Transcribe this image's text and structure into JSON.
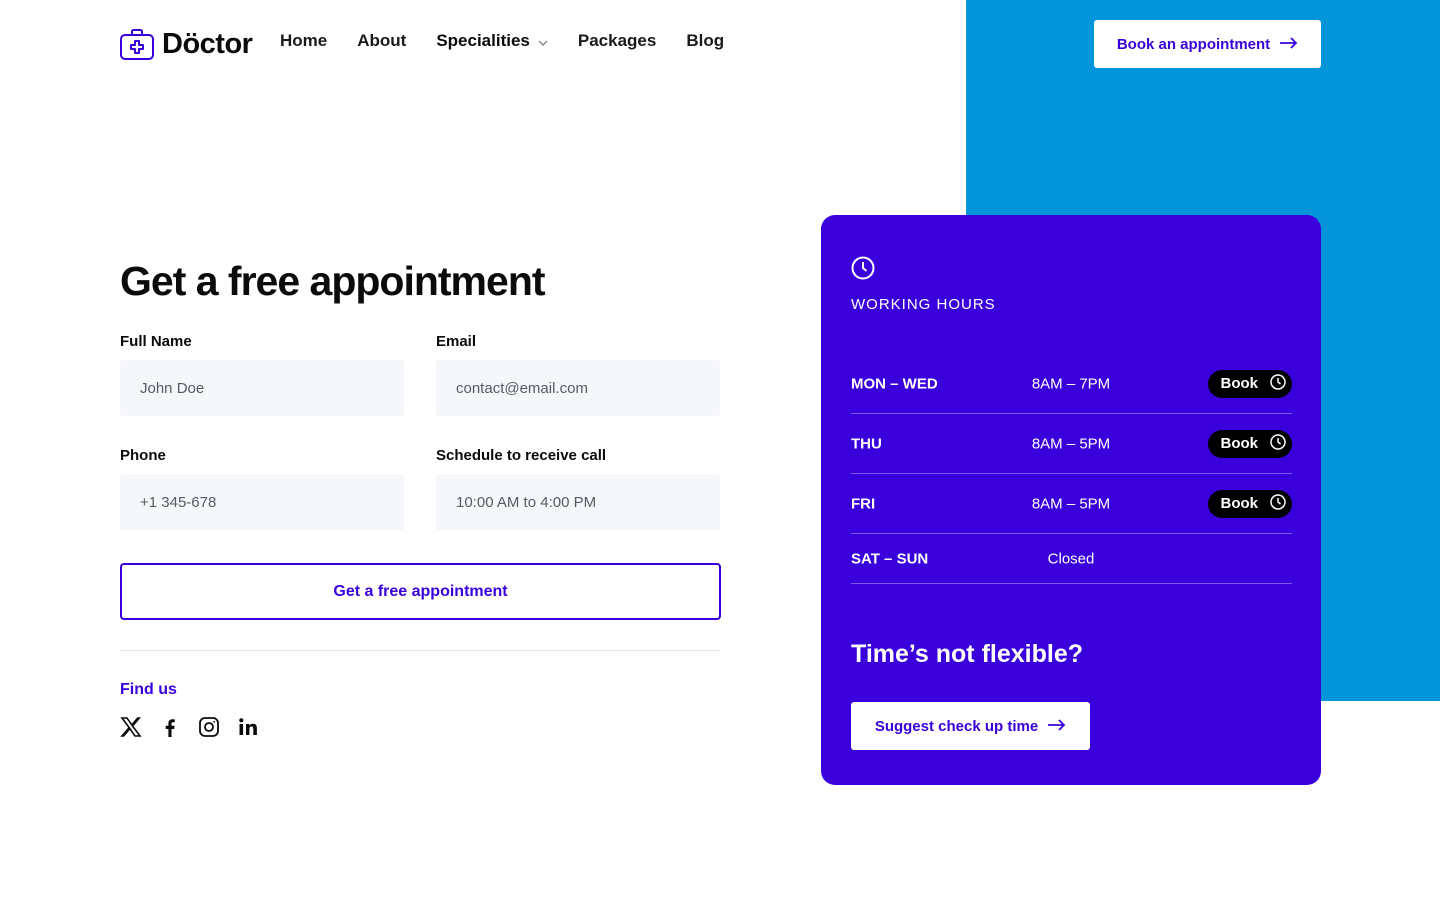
{
  "colors": {
    "accent": "#3a00dc",
    "sky": "#0295d9",
    "input_bg": "#f6f7fb"
  },
  "brand": {
    "name": "Döctor",
    "icon": "medical-case-icon"
  },
  "nav": {
    "items": [
      {
        "label": "Home"
      },
      {
        "label": "About"
      },
      {
        "label": "Specialities",
        "has_dropdown": true
      },
      {
        "label": "Packages"
      },
      {
        "label": "Blog"
      }
    ]
  },
  "header": {
    "cta_label": "Book an appointment",
    "cta_icon": "arrow-right-icon"
  },
  "form": {
    "title": "Get a free appointment",
    "fields": [
      {
        "label": "Full Name",
        "placeholder": "John Doe"
      },
      {
        "label": "Email",
        "placeholder": "contact@email.com"
      },
      {
        "label": "Phone",
        "placeholder": "+1 345-678"
      },
      {
        "label": "Schedule to receive call",
        "placeholder": "10:00 AM to 4:00 PM"
      }
    ],
    "submit_label": "Get a free appointment"
  },
  "find_us": {
    "label": "Find us",
    "icons": [
      "x-twitter-icon",
      "facebook-icon",
      "instagram-icon",
      "linkedin-icon"
    ]
  },
  "hours": {
    "title": "WORKING HOURS",
    "icon": "clock-icon",
    "rows": [
      {
        "day": "MON – WED",
        "time": "8AM – 7PM",
        "book": "Book"
      },
      {
        "day": "THU",
        "time": "8AM – 5PM",
        "book": "Book"
      },
      {
        "day": "FRI",
        "time": "8AM – 5PM",
        "book": "Book"
      },
      {
        "day": "SAT – SUN",
        "time": "Closed"
      }
    ],
    "flex_title": "Time’s not flexible?",
    "suggest_label": "Suggest check up time"
  }
}
